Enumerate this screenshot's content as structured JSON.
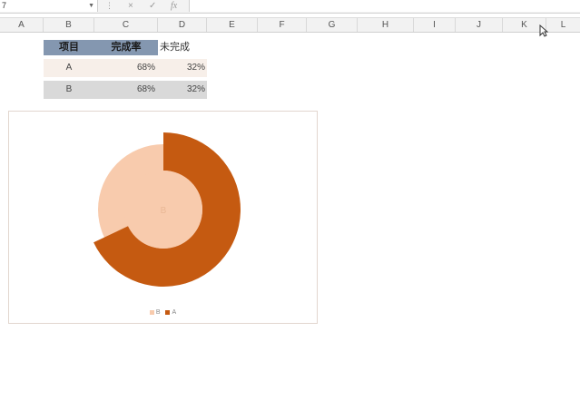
{
  "formula_bar": {
    "name_box": "7",
    "cancel_icon": "×",
    "enter_icon": "✓",
    "fx_label": "fx",
    "formula_value": ""
  },
  "columns": [
    "A",
    "B",
    "C",
    "D",
    "E",
    "F",
    "G",
    "H",
    "I",
    "J",
    "K",
    "L"
  ],
  "table": {
    "headers": [
      "项目",
      "完成率",
      "未完成"
    ],
    "rows": [
      {
        "item": "A",
        "rate": "68%",
        "incomplete": "32%"
      },
      {
        "item": "B",
        "rate": "68%",
        "incomplete": "32%"
      }
    ]
  },
  "chart_data": {
    "type": "doughnut",
    "rings": [
      {
        "name": "B",
        "values": [
          68,
          32
        ],
        "color": "#f8cbad"
      },
      {
        "name": "A",
        "values": [
          68,
          32
        ],
        "color": "#c55a11"
      }
    ],
    "legend": [
      {
        "label": "B",
        "color": "#f8cbad"
      },
      {
        "label": "A",
        "color": "#c55a11"
      }
    ],
    "legend_position": "bottom",
    "center_label": "B"
  },
  "colors": {
    "header_fill": "#8497b0",
    "row1_fill": "#f7efe9",
    "row2_fill": "#d9d9d9"
  }
}
